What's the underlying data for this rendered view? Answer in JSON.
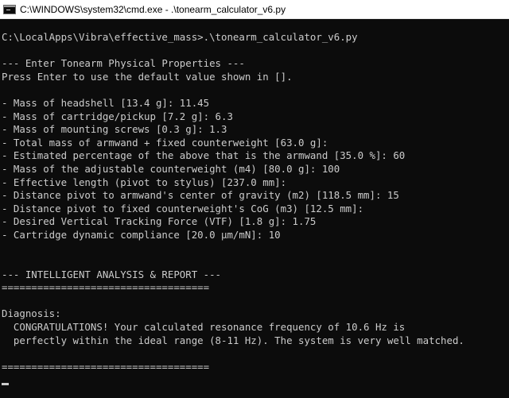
{
  "window": {
    "title": "C:\\WINDOWS\\system32\\cmd.exe - .\\tonearm_calculator_v6.py",
    "icon": "console-icon"
  },
  "console": {
    "lines": [
      "C:\\LocalApps\\Vibra\\effective_mass>.\\tonearm_calculator_v6.py",
      "",
      "--- Enter Tonearm Physical Properties ---",
      "Press Enter to use the default value shown in [].",
      "",
      "- Mass of headshell [13.4 g]: 11.45",
      "- Mass of cartridge/pickup [7.2 g]: 6.3",
      "- Mass of mounting screws [0.3 g]: 1.3",
      "- Total mass of armwand + fixed counterweight [63.0 g]:",
      "- Estimated percentage of the above that is the armwand [35.0 %]: 60",
      "- Mass of the adjustable counterweight (m4) [80.0 g]: 100",
      "- Effective length (pivot to stylus) [237.0 mm]:",
      "- Distance pivot to armwand's center of gravity (m2) [118.5 mm]: 15",
      "- Distance pivot to fixed counterweight's CoG (m3) [12.5 mm]:",
      "- Desired Vertical Tracking Force (VTF) [1.8 g]: 1.75",
      "- Cartridge dynamic compliance [20.0 µm/mN]: 10",
      "",
      "",
      "--- INTELLIGENT ANALYSIS & REPORT ---",
      "===================================",
      "",
      "Diagnosis:",
      "  CONGRATULATIONS! Your calculated resonance frequency of 10.6 Hz is",
      "  perfectly within the ideal range (8-11 Hz). The system is very well matched.",
      "",
      "==================================="
    ]
  },
  "colors": {
    "background": "#0c0c0c",
    "text": "#cccccc",
    "titlebar": "#ffffff"
  }
}
